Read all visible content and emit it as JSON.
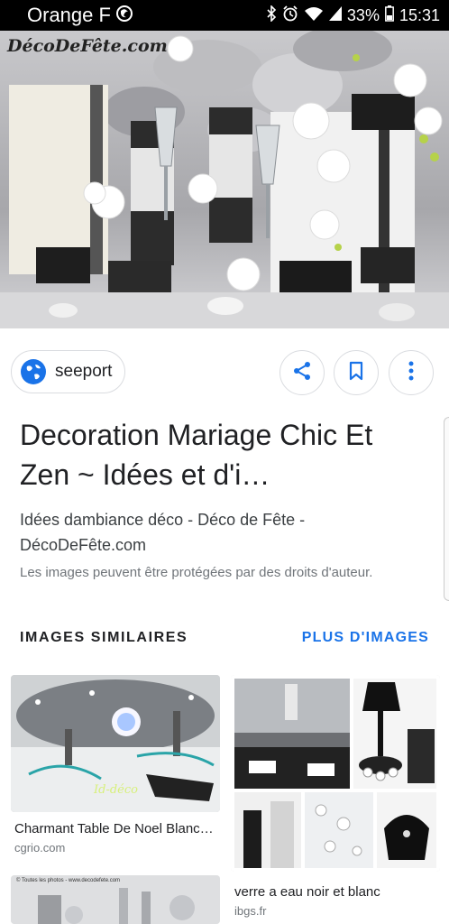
{
  "status_bar": {
    "carrier": "Orange F",
    "battery": "33%",
    "time": "15:31",
    "icons": [
      "firefox-icon",
      "bluetooth-icon",
      "alarm-icon",
      "wifi-icon",
      "signal-icon",
      "battery-icon"
    ]
  },
  "hero": {
    "watermark": "DécoDeFête.com"
  },
  "source": {
    "site": "seeport",
    "icon": "globe-icon"
  },
  "actions": {
    "share_icon": "share-icon",
    "save_icon": "bookmark-icon",
    "more_icon": "more-vert-icon"
  },
  "result": {
    "title": "Decoration Mariage Chic Et Zen ~ Idées et d'i…",
    "subtitle": "Idées dambiance déco - Déco de Fête - DécoDeFête.com",
    "copyright": "Les images peuvent être protégées par des droits d'auteur."
  },
  "similar": {
    "heading": "IMAGES SIMILAIRES",
    "more_link": "PLUS D'IMAGES",
    "items": [
      {
        "title": "Charmant Table De Noel Blanc…",
        "domain": "cgrio.com",
        "caption_overlay": "Id-déco"
      },
      {
        "title": "verre a eau noir et blanc",
        "domain": "ibgs.fr"
      },
      {
        "title": "",
        "domain": "",
        "caption_overlay": "© Toutes les photos - www.decodefete.com"
      }
    ]
  },
  "colors": {
    "accent": "#1a73e8",
    "text_primary": "#202124",
    "text_secondary": "#70757a",
    "border": "#dadce0"
  }
}
